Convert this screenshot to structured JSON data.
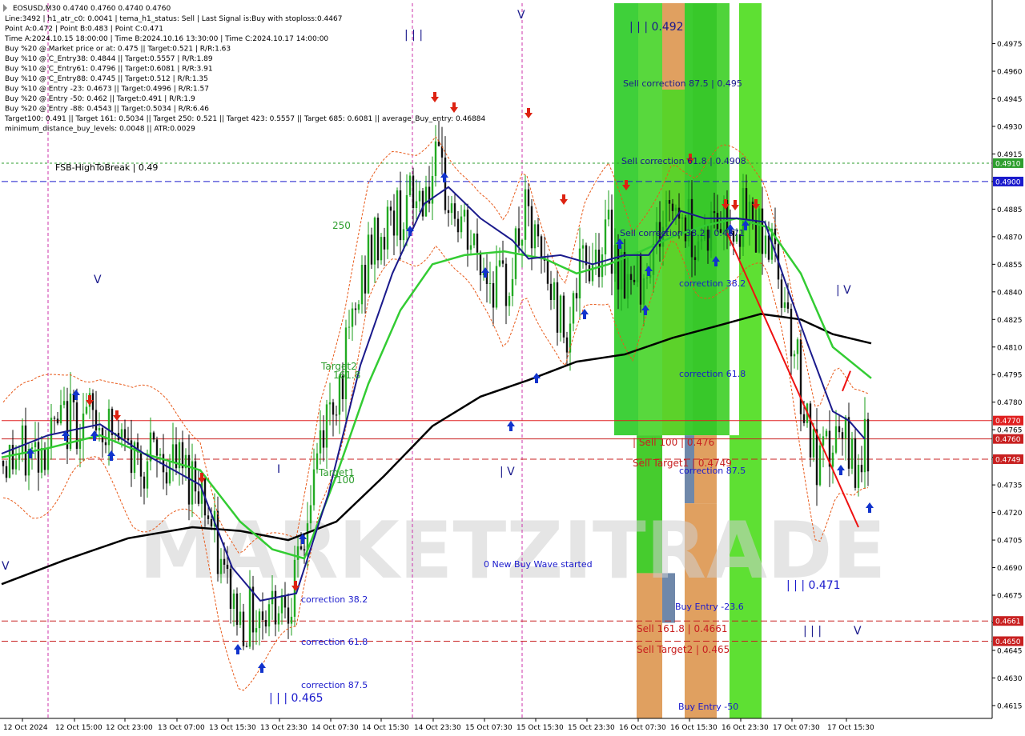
{
  "chart_data": {
    "type": "candlestick",
    "symbol": "EOSUSD",
    "timeframe": "M30",
    "ohlc_header": "EOSUSD,M30  0.4740 0.4760 0.4740 0.4760",
    "info_lines": [
      "Line:3492 | h1_atr_c0: 0.0041 | tema_h1_status: Sell | Last Signal is:Buy with stoploss:0.4467",
      "Point A:0.472 | Point B:0.483 | Point C:0.471",
      "Time A:2024.10.15 18:00:00 | Time B:2024.10.16 13:30:00 | Time C:2024.10.17 14:00:00",
      "Buy %20 @ Market price or at: 0.475 || Target:0.521 | R/R:1.63",
      "Buy %10 @ C_Entry38: 0.4844 || Target:0.5557 | R/R:1.89",
      "Buy %10 @ C_Entry61: 0.4796 || Target:0.6081 | R/R:3.91",
      "Buy %10 @ C_Entry88: 0.4745 || Target:0.512 | R/R:1.35",
      "Buy %10 @ Entry -23: 0.4673 || Target:0.4996 | R/R:1.57",
      "Buy %20 @ Entry -50: 0.462 || Target:0.491 | R/R:1.9",
      "Buy %20 @ Entry -88: 0.4543 || Target:0.5034 | R/R:6.46",
      "Target100: 0.491 || Target 161: 0.5034 || Target 250: 0.521 || Target 423: 0.5557 || Target 685: 0.6081 || average_Buy_entry: 0.46884",
      "minimum_distance_buy_levels: 0.0048 || ATR:0.0029"
    ],
    "y_axis": {
      "min": 0.4608,
      "max": 0.4997,
      "ticks": [
        "0.4975",
        "0.4960",
        "0.4945",
        "0.4930",
        "0.4915",
        "0.4900",
        "0.4885",
        "0.4870",
        "0.4855",
        "0.4840",
        "0.4825",
        "0.4810",
        "0.4795",
        "0.4780",
        "0.4765",
        "0.4750",
        "0.4735",
        "0.4720",
        "0.4705",
        "0.4690",
        "0.4675",
        "0.4660",
        "0.4645",
        "0.4630",
        "0.4615"
      ]
    },
    "x_axis": {
      "ticks": [
        "12 Oct 2024",
        "12 Oct 15:00",
        "12 Oct 23:00",
        "13 Oct 07:00",
        "13 Oct 15:30",
        "13 Oct 23:30",
        "14 Oct 07:30",
        "14 Oct 15:30",
        "14 Oct 23:30",
        "15 Oct 07:30",
        "15 Oct 15:30",
        "15 Oct 23:30",
        "16 Oct 07:30",
        "16 Oct 15:30",
        "16 Oct 23:30",
        "17 Oct 07:30",
        "17 Oct 15:30"
      ]
    },
    "horizontal_levels": [
      {
        "price": 0.491,
        "label": "0.4910",
        "color": "#2e9e2e",
        "style": "dotted"
      },
      {
        "price": 0.49,
        "label": "0.4900",
        "color": "#1a1acc",
        "style": "dashed"
      },
      {
        "price": 0.477,
        "label": "0.4770",
        "color": "#e02020",
        "style": "solid"
      },
      {
        "price": 0.476,
        "label": "0.4760",
        "color": "#c82020",
        "style": "solid"
      },
      {
        "price": 0.4749,
        "label": "0.4749",
        "color": "#c82020",
        "style": "dashed"
      },
      {
        "price": 0.4661,
        "label": "0.4661",
        "color": "#c82020",
        "style": "dashed"
      },
      {
        "price": 0.465,
        "label": "0.4650",
        "color": "#c82020",
        "style": "dashed"
      }
    ],
    "current_price": "0.4760",
    "bands": [
      {
        "from_date": "16 Oct 07:30",
        "color": "#39c82a",
        "price_from": 0.4762,
        "price_to": 0.4997,
        "tone": "green"
      },
      {
        "from_date": "16 Oct 15:30",
        "color": "#39c82a",
        "price_from": 0.4762,
        "price_to": 0.4997,
        "tone": "green"
      },
      {
        "from_date": "16 Oct 23:30",
        "color": "#39c82a",
        "price_from": 0.4608,
        "price_to": 0.4997,
        "tone": "green"
      }
    ],
    "series": [
      {
        "name": "",
        "color": "#1a1a8c",
        "values_from": "tema"
      },
      {
        "name": "",
        "color": "#33cc33",
        "values_from": "ema_slow"
      },
      {
        "name": "",
        "color": "#000000",
        "values_from": "ma200"
      }
    ],
    "annotations": [
      {
        "text": "FSB-HighToBreak | 0.49",
        "color": "#000000"
      },
      {
        "text": "| | | 0.492",
        "color": "#1a1a8c"
      },
      {
        "text": "Sell correction 87.5 | 0.495",
        "color": "#1a1a8c"
      },
      {
        "text": "Sell correction 61.8 | 0.4908",
        "color": "#1a1a8c"
      },
      {
        "text": "Sell correction 38.2 | 0.4871",
        "color": "#1a1a8c"
      },
      {
        "text": "correction 38.2",
        "color": "#1a1acc"
      },
      {
        "text": "correction 61.8",
        "color": "#1a1acc"
      },
      {
        "text": "correction 87.5",
        "color": "#1a1acc"
      },
      {
        "text": "| Sell 100 | 0.476",
        "color": "#c82020"
      },
      {
        "text": "Sell Target1 | 0.4749",
        "color": "#c82020"
      },
      {
        "text": "Sell 161.8 | 0.4661",
        "color": "#c82020"
      },
      {
        "text": "Sell Target2 | 0.465",
        "color": "#c82020"
      },
      {
        "text": "Buy Entry -23.6",
        "color": "#1a1acc"
      },
      {
        "text": "Buy Entry -50",
        "color": "#1a1acc"
      },
      {
        "text": "| | | 0.471",
        "color": "#1a1acc"
      },
      {
        "text": "| | | 0.465",
        "color": "#1a1acc"
      },
      {
        "text": "0 New Buy Wave started",
        "color": "#1a1acc"
      },
      {
        "text": "correction 38.2",
        "color": "#1a1acc"
      },
      {
        "text": "correction 61.8",
        "color": "#1a1acc"
      },
      {
        "text": "correction 87.5",
        "color": "#1a1acc"
      },
      {
        "text": "Target2",
        "color": "#2e9e2e"
      },
      {
        "text": "161.8",
        "color": "#2e9e2e"
      },
      {
        "text": "Target1",
        "color": "#2e9e2e"
      },
      {
        "text": "100",
        "color": "#2e9e2e"
      },
      {
        "text": "250",
        "color": "#2e9e2e"
      }
    ],
    "wave_labels": [
      "| | |",
      "V",
      "V",
      "| V",
      "I",
      "| V",
      "| | |",
      "V",
      "V"
    ],
    "watermark": "MARKETZITRADE"
  }
}
